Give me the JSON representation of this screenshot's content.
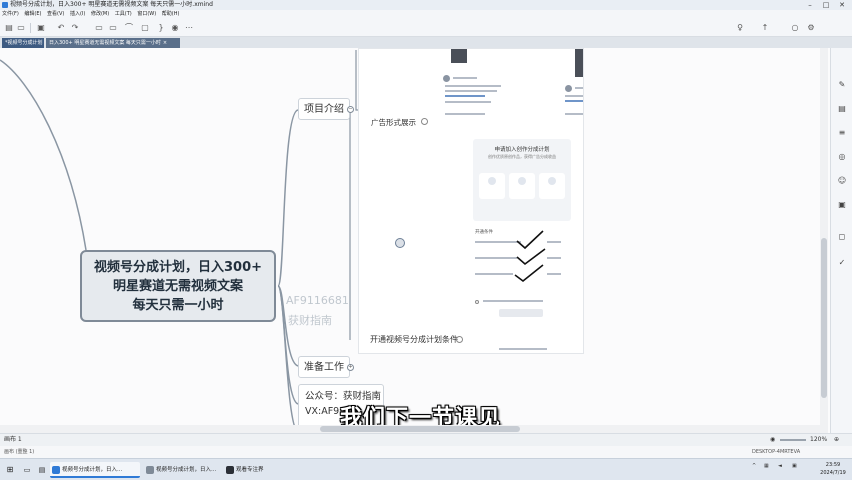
{
  "window": {
    "title": "视频号分成计划，日入300+ 明星赛道无需视频文案 每天只需一小时.xmind"
  },
  "menu": [
    "文件(F)",
    "编辑(E)",
    "查看(V)",
    "插入(I)",
    "修改(M)",
    "工具(T)",
    "窗口(W)",
    "帮助(H)"
  ],
  "tabs": [
    {
      "label": "*视频号分成计划"
    },
    {
      "label": "日入300+ 明星赛道无需视频文案 每天只需一小时"
    }
  ],
  "mindmap": {
    "root_lines": [
      "视频号分成计划，日入300+",
      "明星赛道无需视频文案",
      "每天只需一小时"
    ],
    "topics": {
      "intro": "项目介绍",
      "prep": "准备工作"
    },
    "official": {
      "line1": "公众号：获财指南",
      "line2": "VX:AF9"
    },
    "watermark": {
      "id": "AF9116681",
      "name": "获财指南"
    },
    "captions": {
      "ad_display": "广告形式展示",
      "conditions": "开通视频号分成计划条件"
    }
  },
  "screenshot": {
    "phone_title": "申请加入创作分成计划",
    "phone_sub": "创作优质原创作品，获得广告分成收益",
    "conditions_heading": "开通条件"
  },
  "subtitle": "我们下一节课见",
  "statusbar": {
    "left": "画布 1",
    "zoom": "120%"
  },
  "statusbar2": {
    "left": "画布 (重整 1)",
    "right": "DESKTOP-4MRTEVA"
  },
  "taskbar": {
    "tasks": [
      {
        "label": "视频号分成计划，日入..."
      },
      {
        "label": "视频号分成计划，日入..."
      },
      {
        "label": "观看专注界"
      }
    ],
    "time": "23:59",
    "date": "2024/7/19"
  }
}
